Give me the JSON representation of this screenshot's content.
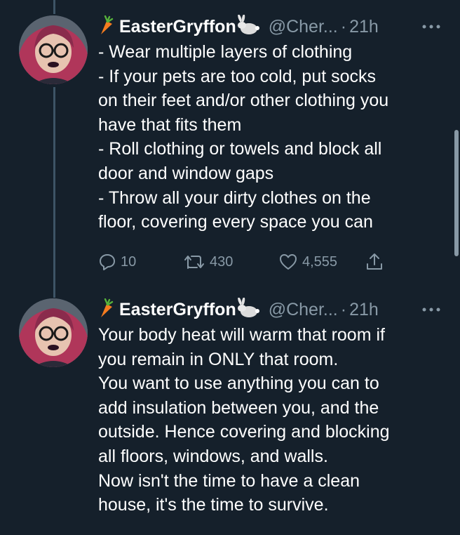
{
  "colors": {
    "background": "#15202b",
    "text": "#ffffff",
    "secondary": "#8899a6",
    "thread": "#3d5466"
  },
  "tweets": [
    {
      "author": {
        "display_name": "EasterGryffon",
        "emoji_left": "carrot-icon",
        "emoji_right": "rabbit-icon",
        "handle": "@Cher...",
        "separator": "·",
        "time": "21h"
      },
      "lines": [
        "- Wear multiple layers of clothing",
        "- If your pets are too cold, put socks",
        "on their feet and/or other clothing you",
        "have that fits them",
        "- Roll clothing or towels and block all",
        "door and window gaps",
        "- Throw all your dirty clothes on the",
        "floor, covering every space you can"
      ],
      "actions": {
        "replies": "10",
        "retweets": "430",
        "likes": "4,555"
      }
    },
    {
      "author": {
        "display_name": "EasterGryffon",
        "emoji_left": "carrot-icon",
        "emoji_right": "rabbit-icon",
        "handle": "@Cher...",
        "separator": "·",
        "time": "21h"
      },
      "lines": [
        "Your body heat will warm that room if",
        "you remain in ONLY that room.",
        "You want to use anything you can to",
        "add insulation between you, and the",
        "outside. Hence covering and blocking",
        "all floors, windows, and walls.",
        "Now isn't the time to have a clean",
        "house, it's the time to survive."
      ]
    }
  ]
}
